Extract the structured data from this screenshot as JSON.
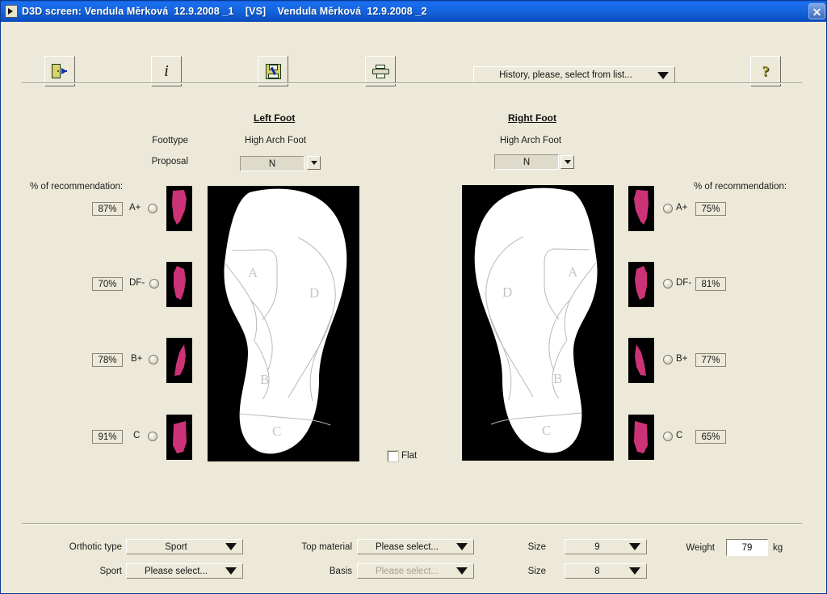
{
  "window": {
    "title": "D3D screen: Vendula Měrková  12.9.2008 _1    [VS]    Vendula Měrková  12.9.2008 _2",
    "icon": "app-icon",
    "close_label": "✕",
    "bg_color": "#ece9d8",
    "titlebar_color": "#1565e0"
  },
  "toolbar": {
    "exit_tooltip": "Exit",
    "info_label": "i",
    "save_tooltip": "Save",
    "print_tooltip": "Print",
    "help_label": "?",
    "history": {
      "label": "History, please, select from list...",
      "arrow": "▼"
    }
  },
  "feet": {
    "left": {
      "header": "Left Foot",
      "footype_label": "Foottype",
      "footype_value": "High Arch Foot",
      "proposal_label": "Proposal",
      "proposal_value": "N",
      "recommendation_label": "% of recommendation:",
      "zones": [
        "A",
        "D",
        "B",
        "C"
      ],
      "rows": [
        {
          "percent": "87%",
          "code": "A+",
          "selected": false
        },
        {
          "percent": "70%",
          "code": "DF-",
          "selected": false
        },
        {
          "percent": "78%",
          "code": "B+",
          "selected": false
        },
        {
          "percent": "91%",
          "code": "C",
          "selected": false
        }
      ]
    },
    "right": {
      "header": "Right Foot",
      "footype_value": "High Arch Foot",
      "proposal_value": "N",
      "recommendation_label": "% of recommendation:",
      "zones": [
        "A",
        "D",
        "B",
        "C"
      ],
      "rows": [
        {
          "percent": "75%",
          "code": "A+",
          "selected": false
        },
        {
          "percent": "81%",
          "code": "DF-",
          "selected": false
        },
        {
          "percent": "77%",
          "code": "B+",
          "selected": false
        },
        {
          "percent": "65%",
          "code": "C",
          "selected": false
        }
      ]
    }
  },
  "flat": {
    "label": "Flat",
    "checked": false
  },
  "bottom": {
    "orthotic_type_label": "Orthotic type",
    "orthotic_type_value": "Sport",
    "sport_label": "Sport",
    "sport_value": "Please select...",
    "top_material_label": "Top material",
    "top_material_value": "Please select...",
    "basis_label": "Basis",
    "basis_value": "Please select...",
    "basis_disabled": true,
    "size_label_1": "Size",
    "size_value_1": "9",
    "size_label_2": "Size",
    "size_value_2": "8",
    "weight_label": "Weight",
    "weight_value": "79",
    "weight_unit": "kg"
  },
  "colors": {
    "pink": "#cc3377",
    "panel_black": "#000000",
    "face": "#ece9d8"
  }
}
